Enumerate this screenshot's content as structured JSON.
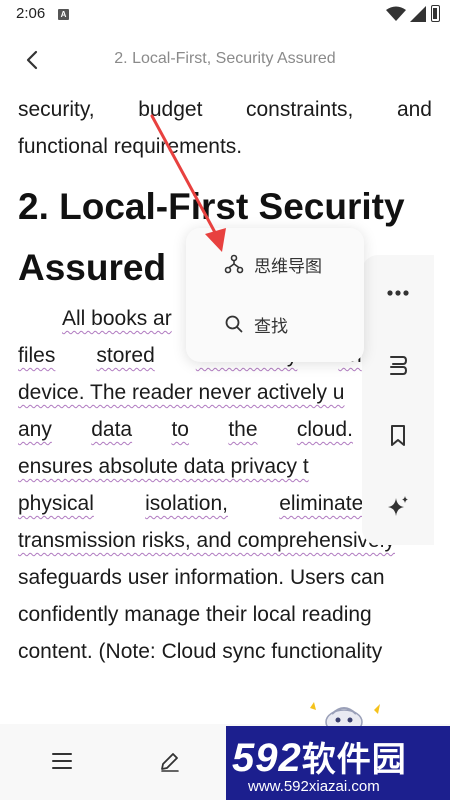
{
  "status_bar": {
    "time": "2:06",
    "notification_icon": "a-app-icon",
    "wifi_icon": "wifi-icon",
    "signal_icon": "signal-icon",
    "battery_icon": "battery-icon"
  },
  "header": {
    "title": "2. Local-First, Security Assured",
    "back_icon": "chevron-left-icon"
  },
  "content": {
    "top_paragraph_lines": [
      [
        "security,",
        "budget",
        "constraints,",
        "and"
      ],
      [
        "functional requirements."
      ]
    ],
    "heading_lines": [
      "2. Local-First  Security",
      "Assured"
    ],
    "body_lines": [
      "All books ar",
      "files stored exclusively on the",
      "device. The reader never actively u",
      "any data to the cloud. This",
      "ensures absolute data privacy t",
      "physical isolation, eliminates r",
      "transmission risks, and comprehensively",
      "safeguards user information. Users can",
      "confidently manage their local reading",
      "content. (Note: Cloud sync functionality"
    ]
  },
  "popup_menu": {
    "items": [
      {
        "label": "思维导图",
        "icon": "mind-map-icon"
      },
      {
        "label": "查找",
        "icon": "search-icon"
      }
    ]
  },
  "side_toolbar": {
    "items": [
      {
        "name": "more",
        "icon": "more-dots-icon"
      },
      {
        "name": "text-style",
        "icon": "text-style-icon"
      },
      {
        "name": "bookmark",
        "icon": "bookmark-icon"
      },
      {
        "name": "ai",
        "icon": "sparkle-icon"
      }
    ]
  },
  "bottom_bar": {
    "items": [
      {
        "name": "menu",
        "icon": "menu-icon"
      },
      {
        "name": "note",
        "icon": "pen-icon"
      }
    ]
  },
  "watermark": {
    "brand_number": "592",
    "brand_text": "软件园",
    "url": "www.592xiazai.com"
  },
  "colors": {
    "accent_arrow": "#e8413f",
    "wavy_underline": "#b07ac0",
    "watermark_bg": "#1c1f8e"
  }
}
